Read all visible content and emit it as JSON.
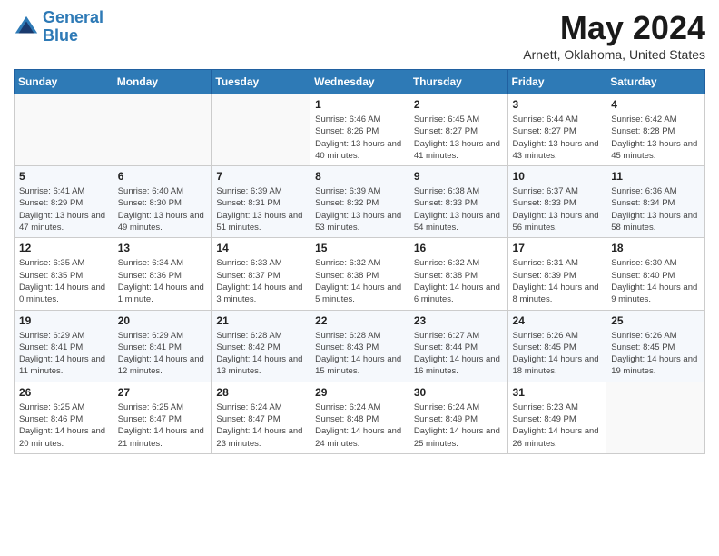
{
  "header": {
    "logo_line1": "General",
    "logo_line2": "Blue",
    "title": "May 2024",
    "subtitle": "Arnett, Oklahoma, United States"
  },
  "weekdays": [
    "Sunday",
    "Monday",
    "Tuesday",
    "Wednesday",
    "Thursday",
    "Friday",
    "Saturday"
  ],
  "weeks": [
    [
      {
        "day": "",
        "sunrise": "",
        "sunset": "",
        "daylight": ""
      },
      {
        "day": "",
        "sunrise": "",
        "sunset": "",
        "daylight": ""
      },
      {
        "day": "",
        "sunrise": "",
        "sunset": "",
        "daylight": ""
      },
      {
        "day": "1",
        "sunrise": "6:46 AM",
        "sunset": "8:26 PM",
        "daylight": "13 hours and 40 minutes."
      },
      {
        "day": "2",
        "sunrise": "6:45 AM",
        "sunset": "8:27 PM",
        "daylight": "13 hours and 41 minutes."
      },
      {
        "day": "3",
        "sunrise": "6:44 AM",
        "sunset": "8:27 PM",
        "daylight": "13 hours and 43 minutes."
      },
      {
        "day": "4",
        "sunrise": "6:42 AM",
        "sunset": "8:28 PM",
        "daylight": "13 hours and 45 minutes."
      }
    ],
    [
      {
        "day": "5",
        "sunrise": "6:41 AM",
        "sunset": "8:29 PM",
        "daylight": "13 hours and 47 minutes."
      },
      {
        "day": "6",
        "sunrise": "6:40 AM",
        "sunset": "8:30 PM",
        "daylight": "13 hours and 49 minutes."
      },
      {
        "day": "7",
        "sunrise": "6:39 AM",
        "sunset": "8:31 PM",
        "daylight": "13 hours and 51 minutes."
      },
      {
        "day": "8",
        "sunrise": "6:39 AM",
        "sunset": "8:32 PM",
        "daylight": "13 hours and 53 minutes."
      },
      {
        "day": "9",
        "sunrise": "6:38 AM",
        "sunset": "8:33 PM",
        "daylight": "13 hours and 54 minutes."
      },
      {
        "day": "10",
        "sunrise": "6:37 AM",
        "sunset": "8:33 PM",
        "daylight": "13 hours and 56 minutes."
      },
      {
        "day": "11",
        "sunrise": "6:36 AM",
        "sunset": "8:34 PM",
        "daylight": "13 hours and 58 minutes."
      }
    ],
    [
      {
        "day": "12",
        "sunrise": "6:35 AM",
        "sunset": "8:35 PM",
        "daylight": "14 hours and 0 minutes."
      },
      {
        "day": "13",
        "sunrise": "6:34 AM",
        "sunset": "8:36 PM",
        "daylight": "14 hours and 1 minute."
      },
      {
        "day": "14",
        "sunrise": "6:33 AM",
        "sunset": "8:37 PM",
        "daylight": "14 hours and 3 minutes."
      },
      {
        "day": "15",
        "sunrise": "6:32 AM",
        "sunset": "8:38 PM",
        "daylight": "14 hours and 5 minutes."
      },
      {
        "day": "16",
        "sunrise": "6:32 AM",
        "sunset": "8:38 PM",
        "daylight": "14 hours and 6 minutes."
      },
      {
        "day": "17",
        "sunrise": "6:31 AM",
        "sunset": "8:39 PM",
        "daylight": "14 hours and 8 minutes."
      },
      {
        "day": "18",
        "sunrise": "6:30 AM",
        "sunset": "8:40 PM",
        "daylight": "14 hours and 9 minutes."
      }
    ],
    [
      {
        "day": "19",
        "sunrise": "6:29 AM",
        "sunset": "8:41 PM",
        "daylight": "14 hours and 11 minutes."
      },
      {
        "day": "20",
        "sunrise": "6:29 AM",
        "sunset": "8:41 PM",
        "daylight": "14 hours and 12 minutes."
      },
      {
        "day": "21",
        "sunrise": "6:28 AM",
        "sunset": "8:42 PM",
        "daylight": "14 hours and 13 minutes."
      },
      {
        "day": "22",
        "sunrise": "6:28 AM",
        "sunset": "8:43 PM",
        "daylight": "14 hours and 15 minutes."
      },
      {
        "day": "23",
        "sunrise": "6:27 AM",
        "sunset": "8:44 PM",
        "daylight": "14 hours and 16 minutes."
      },
      {
        "day": "24",
        "sunrise": "6:26 AM",
        "sunset": "8:45 PM",
        "daylight": "14 hours and 18 minutes."
      },
      {
        "day": "25",
        "sunrise": "6:26 AM",
        "sunset": "8:45 PM",
        "daylight": "14 hours and 19 minutes."
      }
    ],
    [
      {
        "day": "26",
        "sunrise": "6:25 AM",
        "sunset": "8:46 PM",
        "daylight": "14 hours and 20 minutes."
      },
      {
        "day": "27",
        "sunrise": "6:25 AM",
        "sunset": "8:47 PM",
        "daylight": "14 hours and 21 minutes."
      },
      {
        "day": "28",
        "sunrise": "6:24 AM",
        "sunset": "8:47 PM",
        "daylight": "14 hours and 23 minutes."
      },
      {
        "day": "29",
        "sunrise": "6:24 AM",
        "sunset": "8:48 PM",
        "daylight": "14 hours and 24 minutes."
      },
      {
        "day": "30",
        "sunrise": "6:24 AM",
        "sunset": "8:49 PM",
        "daylight": "14 hours and 25 minutes."
      },
      {
        "day": "31",
        "sunrise": "6:23 AM",
        "sunset": "8:49 PM",
        "daylight": "14 hours and 26 minutes."
      },
      {
        "day": "",
        "sunrise": "",
        "sunset": "",
        "daylight": ""
      }
    ]
  ],
  "labels": {
    "sunrise_prefix": "Sunrise: ",
    "sunset_prefix": "Sunset: ",
    "daylight_prefix": "Daylight: "
  }
}
